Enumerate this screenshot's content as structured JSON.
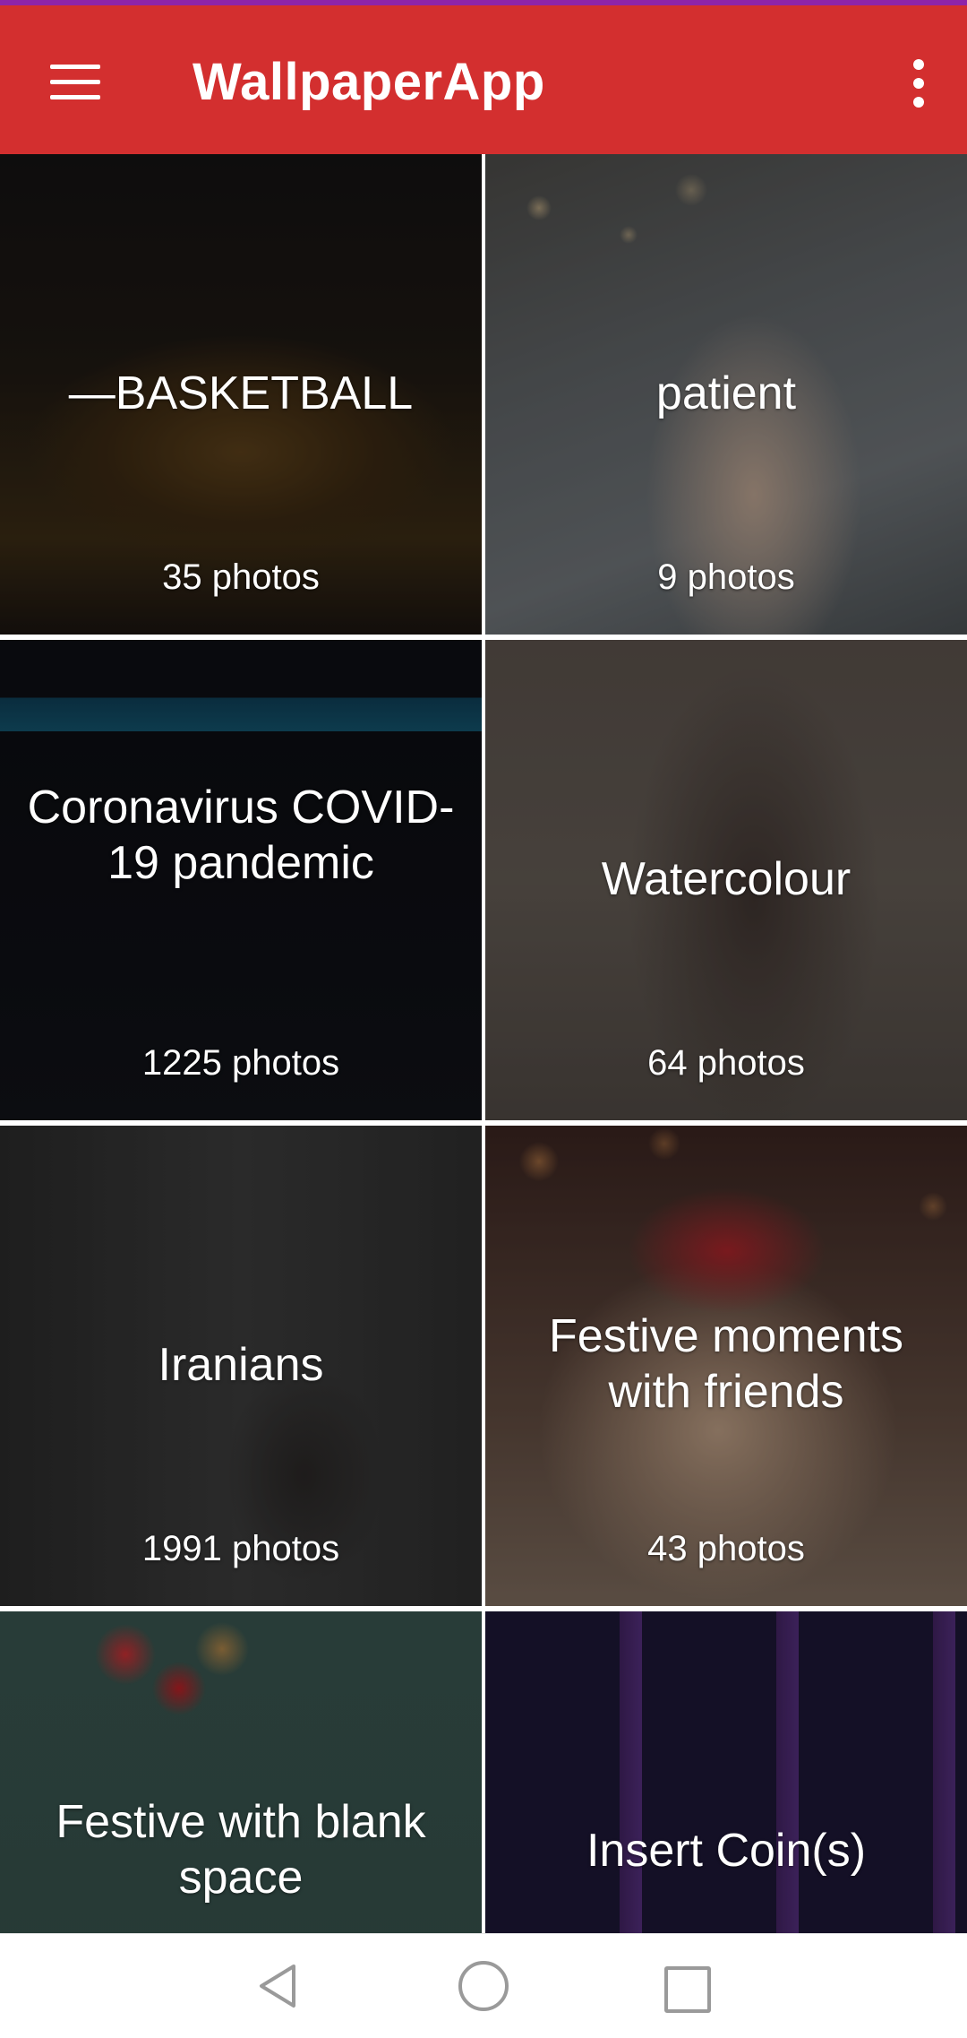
{
  "app_bar": {
    "title": "WallpaperApp",
    "menu_icon": "hamburger-menu-icon",
    "more_icon": "more-vertical-icon",
    "color": "#d32f2f"
  },
  "categories": [
    {
      "title": "—BASKETBALL",
      "count": "35 photos"
    },
    {
      "title": "patient",
      "count": "9 photos"
    },
    {
      "title": "Coronavirus COVID-19 pandemic",
      "count": "1225 photos"
    },
    {
      "title": "Watercolour",
      "count": "64 photos"
    },
    {
      "title": "Iranians",
      "count": "1991 photos"
    },
    {
      "title": "Festive moments with friends",
      "count": "43 photos"
    },
    {
      "title": "Festive with blank space",
      "count": ""
    },
    {
      "title": "Insert Coin(s)",
      "count": ""
    }
  ],
  "nav_bar": {
    "back_icon": "back-triangle-icon",
    "home_icon": "home-circle-icon",
    "recents_icon": "recents-square-icon"
  }
}
